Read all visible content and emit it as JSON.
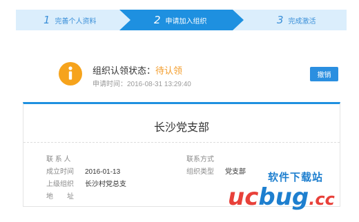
{
  "steps": [
    {
      "num": "1",
      "label": "完善个人资料"
    },
    {
      "num": "2",
      "label": "申请加入组织"
    },
    {
      "num": "3",
      "label": "完成激活"
    }
  ],
  "status": {
    "title_prefix": "组织认领状态：",
    "value": "待认领",
    "apply_time": "申请时间：2016-08-31 13:29:40",
    "revoke_label": "撤销"
  },
  "card": {
    "org_name": "长沙党支部",
    "fields": {
      "contact_label": "联 系 人",
      "contact_value": "",
      "phone_label": "联系方式",
      "phone_value": "",
      "founded_label": "成立时间",
      "founded_value": "2016-01-13",
      "type_label": "组织类型",
      "type_value": "党支部",
      "parent_label": "上级组织",
      "parent_value": "长沙村党总支",
      "address_label": "地　　址",
      "address_value": ""
    }
  },
  "watermark": {
    "cn_text": "软件下载站",
    "uc": "uc",
    "bug": "bug",
    "cc": ".cc"
  },
  "colors": {
    "accent": "#1e90e0",
    "step_inactive_bg": "#dbeefc",
    "status_orange": "#f39c2a",
    "icon_orange": "#f6a31c"
  }
}
